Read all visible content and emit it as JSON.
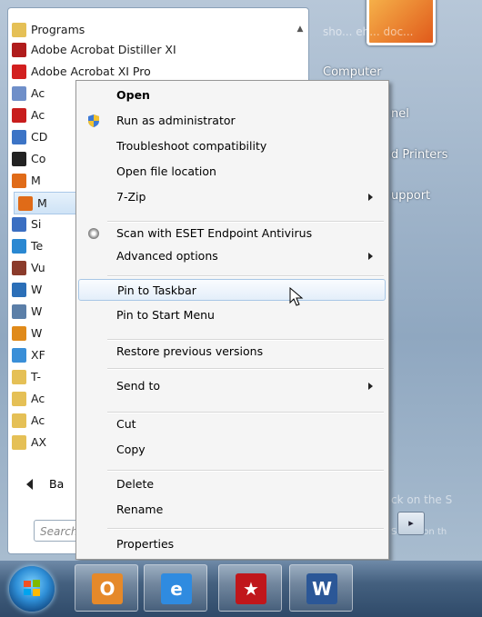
{
  "programs": {
    "folder_label": "Programs",
    "items": [
      {
        "label": "Adobe Acrobat Distiller XI",
        "icon": "acrobat-distiller-icon",
        "color": "#b01c1c"
      },
      {
        "label": "Adobe Acrobat XI Pro",
        "icon": "acrobat-icon",
        "color": "#d21f1f"
      },
      {
        "label": "Ac",
        "icon": "document-icon",
        "color": "#6f8fc9"
      },
      {
        "label": "Ac",
        "icon": "acrobat-reader-icon",
        "color": "#c81d1d"
      },
      {
        "label": "CD",
        "icon": "cd-icon",
        "color": "#3c74c6"
      },
      {
        "label": "Co",
        "icon": "app-icon",
        "color": "#222222"
      },
      {
        "label": "M",
        "icon": "firefox-icon",
        "color": "#e06b18"
      },
      {
        "label": "M",
        "icon": "firefox-icon",
        "color": "#e06b18"
      },
      {
        "label": "Si",
        "icon": "app-icon",
        "color": "#3b6fc2"
      },
      {
        "label": "Te",
        "icon": "app-icon",
        "color": "#2a88d2"
      },
      {
        "label": "Vu",
        "icon": "app-icon",
        "color": "#8b3b2b"
      },
      {
        "label": "W",
        "icon": "app-icon",
        "color": "#2b6fb8"
      },
      {
        "label": "W",
        "icon": "app-icon",
        "color": "#5b7fa8"
      },
      {
        "label": "W",
        "icon": "app-icon",
        "color": "#e08a1a"
      },
      {
        "label": "XF",
        "icon": "app-icon",
        "color": "#3a8fd8"
      },
      {
        "label": "T-",
        "icon": "folder-icon",
        "color": "#e5c056"
      },
      {
        "label": "Ac",
        "icon": "folder-icon",
        "color": "#e5c056"
      },
      {
        "label": "Ac",
        "icon": "folder-icon",
        "color": "#e5c056"
      },
      {
        "label": "AX",
        "icon": "folder-icon",
        "color": "#e5c056"
      }
    ],
    "back_label": "Ba",
    "search_placeholder": "Search"
  },
  "right_pane": {
    "computer": "Computer",
    "control_panel_partial": "nel",
    "devices_partial": "d Printers",
    "help_partial": "upport",
    "faint_top": "sho...  eh...  doc...",
    "faint_bottom1": "ck on the S",
    "faint_bottom2": "SETUP on th",
    "shutdown_label": "▸"
  },
  "context_menu": {
    "items": [
      {
        "label": "Open",
        "bold": true
      },
      {
        "label": "Run as administrator",
        "icon": "shield-icon"
      },
      {
        "label": "Troubleshoot compatibility"
      },
      {
        "label": "Open file location"
      },
      {
        "label": "7-Zip",
        "submenu": true
      },
      {
        "label": "Scan with ESET Endpoint Antivirus",
        "icon": "eset-icon"
      },
      {
        "label": "Advanced options",
        "submenu": true
      },
      {
        "label": "Pin to Taskbar",
        "highlighted": true
      },
      {
        "label": "Pin to Start Menu"
      },
      {
        "label": "Restore previous versions"
      },
      {
        "label": "Send to",
        "submenu": true
      },
      {
        "label": "Cut"
      },
      {
        "label": "Copy"
      },
      {
        "label": "Delete"
      },
      {
        "label": "Rename"
      },
      {
        "label": "Properties"
      }
    ]
  },
  "taskbar": {
    "apps": [
      {
        "name": "outlook",
        "icon": "outlook-icon",
        "glyph": "O",
        "color": "#e5892a"
      },
      {
        "name": "internet-explorer",
        "icon": "ie-icon",
        "glyph": "e",
        "color": "#2f8be0"
      },
      {
        "name": "acrobat",
        "icon": "acrobat-icon",
        "glyph": "★",
        "color": "#c0161b"
      },
      {
        "name": "word",
        "icon": "word-icon",
        "glyph": "W",
        "color": "#2b5797"
      }
    ]
  }
}
